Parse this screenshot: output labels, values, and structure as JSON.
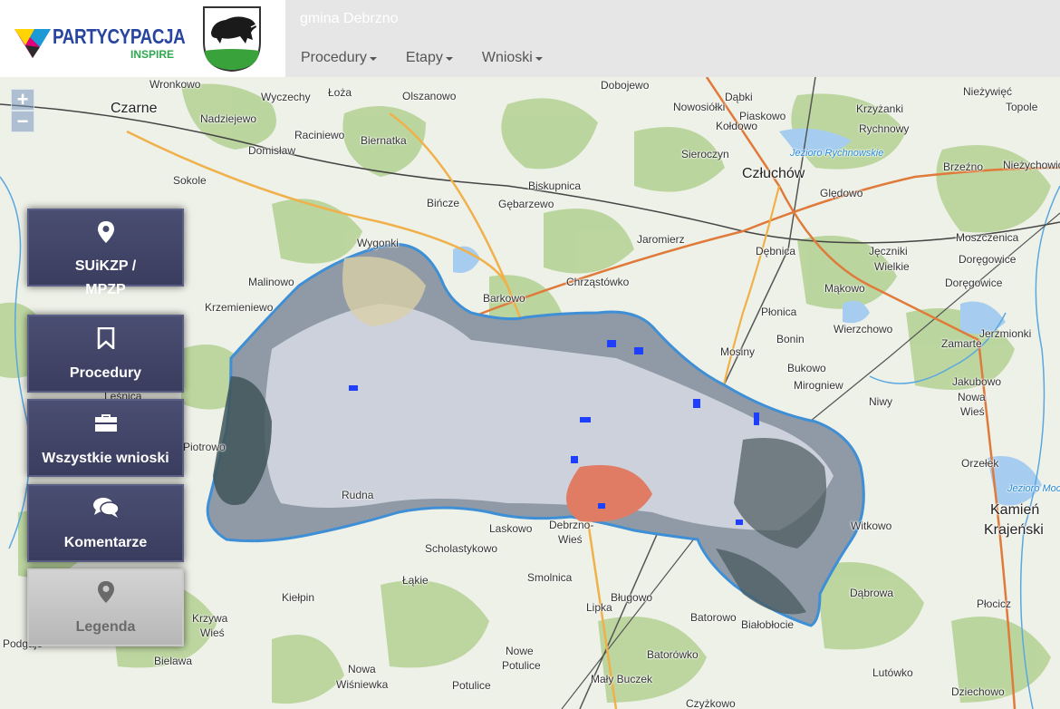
{
  "brand": {
    "logo_text": "PARTYCYPACJA",
    "logo_sub": "INSPIRE"
  },
  "header": {
    "gmina_title": "gmina Debrzno"
  },
  "nav": {
    "items": [
      "Procedury",
      "Etapy",
      "Wnioski"
    ]
  },
  "zoom": {
    "in": "+",
    "out": "−"
  },
  "sidebar": {
    "items": [
      {
        "label_line1": "SUiKZP /",
        "label_line2": "MPZP",
        "icon": "map-marker-icon"
      },
      {
        "label": "Procedury",
        "icon": "bookmark-icon"
      },
      {
        "label": "Wszystkie wnioski",
        "icon": "briefcase-icon"
      },
      {
        "label": "Komentarze",
        "icon": "comments-icon"
      },
      {
        "label": "Legenda",
        "icon": "map-marker-icon"
      }
    ]
  },
  "map": {
    "places": [
      "Wronkowo",
      "Wyczechy",
      "Łoża",
      "Olszanowo",
      "Dobojewo",
      "Dąbki",
      "Nowosiółki",
      "Piaskowo",
      "Kołdowo",
      "Krzyżanki",
      "Rychnowy",
      "Nieżywięć",
      "Topole",
      "Czarne",
      "Nadziejewo",
      "Raciniewo",
      "Biernatka",
      "Domisław",
      "Sieroczyn",
      "Człuchów",
      "Jezioro Rychnowskie",
      "Brzeźno",
      "Nieżychowice",
      "Sokole",
      "Biskupnica",
      "Bińcze",
      "Gębarzewo",
      "Ględowo",
      "Jaromierz",
      "Dębnica",
      "Jęczniki",
      "Wielkie",
      "Moszczenica",
      "Doręgowice",
      "Wygonki",
      "Malinowo",
      "Krzemieniewo",
      "Barkowo",
      "Chrząstówko",
      "Mąkowo",
      "Doręgowice",
      "Płonica",
      "Wierzchowo",
      "Jerzmionki",
      "Zamarte",
      "Mosiny",
      "Bonin",
      "Bukowo",
      "Mirogniew",
      "Niwy",
      "Jakubowo",
      "Nowa",
      "Wieś",
      "Orzełek",
      "Jezioro Mochel",
      "Leśnica",
      "Piotrowo",
      "Rudna",
      "Laskowo",
      "Debrzno-",
      "Wieś",
      "Witkowo",
      "Kamień",
      "Krajeński",
      "Scholastykowo",
      "Łąkie",
      "Smolnica",
      "Lipka",
      "Bługowo",
      "Batorowo",
      "Białobłocie",
      "Dąbrowa",
      "Płocicz",
      "Kiełpin",
      "Krzywa",
      "Wieś",
      "Podgaje",
      "Bielawa",
      "Nowa",
      "Wiśniewka",
      "Nowe",
      "Potulice",
      "Potulice",
      "Batorówko",
      "Mały Buczek",
      "Lutówko",
      "Dziechowo",
      "Czyżkowo"
    ]
  }
}
